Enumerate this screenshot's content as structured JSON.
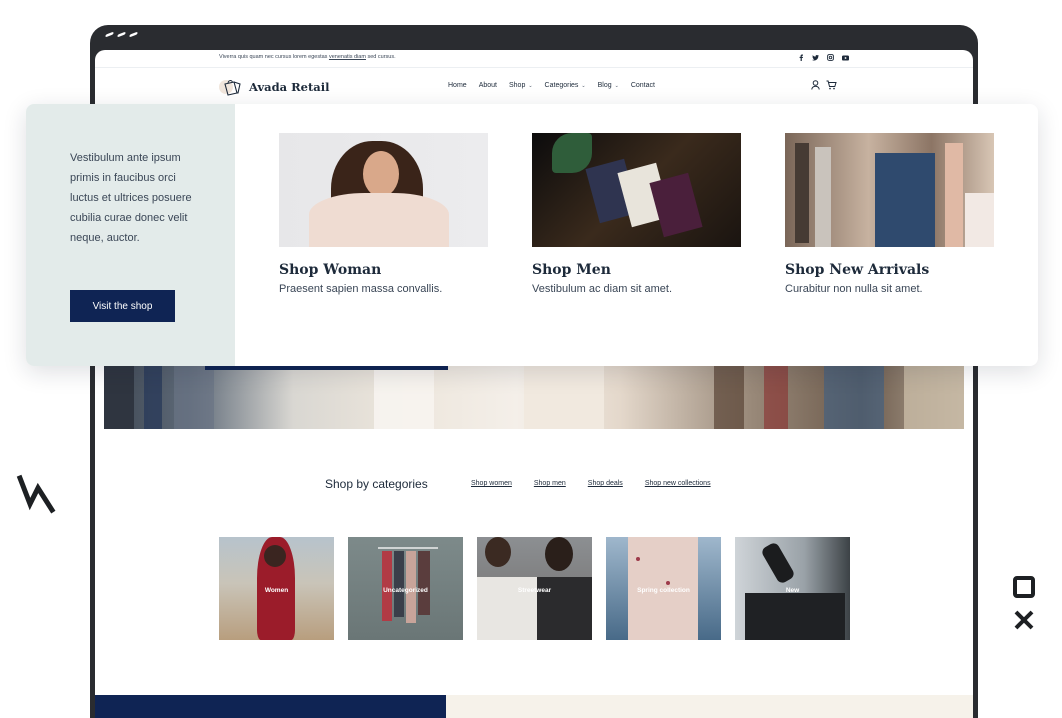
{
  "topbar": {
    "text_before": "Viverra quis quam nec cursus lorem egestas",
    "link_text": "venenatis diam",
    "text_after": "sed cursus."
  },
  "header": {
    "logo_text": "Avada Retail",
    "nav": [
      {
        "label": "Home"
      },
      {
        "label": "About"
      },
      {
        "label": "Shop"
      },
      {
        "label": "Categories"
      },
      {
        "label": "Blog"
      },
      {
        "label": "Contact"
      }
    ]
  },
  "mega_menu": {
    "description": "Vestibulum ante ipsum primis in faucibus orci luctus et ultrices posuere cubilia curae donec velit neque, auctor.",
    "button_label": "Visit the shop",
    "cards": [
      {
        "title": "Shop Woman",
        "subtitle": "Praesent sapien massa convallis."
      },
      {
        "title": "Shop Men",
        "subtitle": "Vestibulum ac diam sit amet."
      },
      {
        "title": "Shop New Arrivals",
        "subtitle": "Curabitur non nulla sit amet."
      }
    ]
  },
  "categories": {
    "title": "Shop by categories",
    "links": [
      "Shop women",
      "Shop men",
      "Shop deals",
      "Shop new collections"
    ],
    "tiles": [
      {
        "label": "Women"
      },
      {
        "label": "Uncategorized"
      },
      {
        "label": "Streetwear"
      },
      {
        "label": "Spring collection"
      },
      {
        "label": "New"
      }
    ]
  },
  "colors": {
    "navy": "#0f2454",
    "frame": "#2a2c30",
    "mint_panel": "#e3ebea",
    "cream": "#f6f2ea"
  }
}
